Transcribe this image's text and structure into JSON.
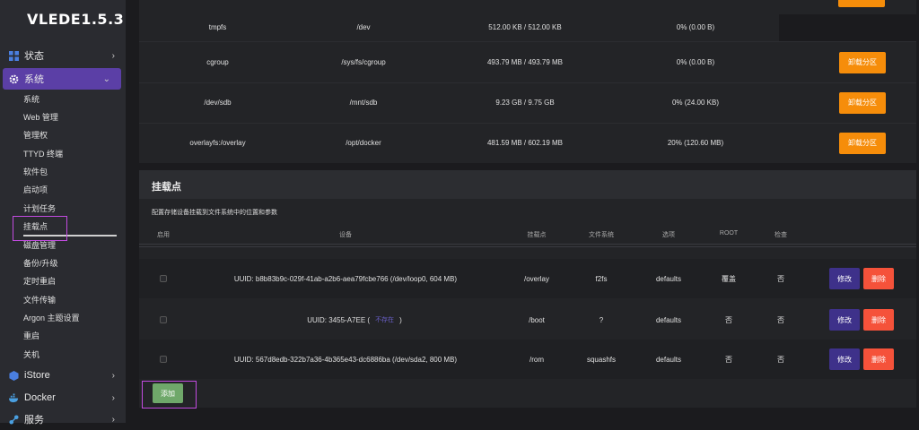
{
  "sidebar": {
    "logo": "VLEDE1.5.3",
    "top_items": [
      {
        "label": "状态",
        "icon": "grid-icon"
      },
      {
        "label": "系统",
        "icon": "gear-icon"
      },
      {
        "label": "iStore",
        "icon": "istore-icon"
      },
      {
        "label": "Docker",
        "icon": "docker-icon"
      },
      {
        "label": "服务",
        "icon": "services-icon"
      }
    ],
    "sub_items": [
      "系统",
      "Web 管理",
      "管理权",
      "TTYD 终端",
      "软件包",
      "启动项",
      "计划任务",
      "挂载点",
      "磁盘管理",
      "备份/升级",
      "定时重启",
      "文件传输",
      "Argon 主题设置",
      "重启",
      "关机"
    ]
  },
  "storage_rows": [
    {
      "fs": "tmpfs",
      "mount": "/dev",
      "size": "512.00 KB / 512.00 KB",
      "usage": "0% (0.00 B)",
      "action": ""
    },
    {
      "fs": "cgroup",
      "mount": "/sys/fs/cgroup",
      "size": "493.79 MB / 493.79 MB",
      "usage": "0% (0.00 B)",
      "action": "卸载分区"
    },
    {
      "fs": "/dev/sdb",
      "mount": "/mnt/sdb",
      "size": "9.23 GB / 9.75 GB",
      "usage": "0% (24.00 KB)",
      "action": "卸载分区"
    },
    {
      "fs": "overlayfs:/overlay",
      "mount": "/opt/docker",
      "size": "481.59 MB / 602.19 MB",
      "usage": "20% (120.60 MB)",
      "action": "卸载分区"
    }
  ],
  "mounts_panel": {
    "title": "挂载点",
    "description": "配置存储设备挂载到文件系统中的位置和参数",
    "headers": [
      "启用",
      "设备",
      "挂载点",
      "文件系统",
      "选项",
      "ROOT",
      "检查"
    ],
    "rows": [
      {
        "device": "UUID: b8b83b9c-029f-41ab-a2b6-aea79fcbe766 (/dev/loop0, 604 MB)",
        "mount": "/overlay",
        "fs": "f2fs",
        "options": "defaults",
        "root": "覆盖",
        "check": "否"
      },
      {
        "device_prefix": "UUID: 3455-A7EE (",
        "device_missing": "不存在",
        "device_suffix": ")",
        "mount": "/boot",
        "fs": "?",
        "options": "defaults",
        "root": "否",
        "check": "否"
      },
      {
        "device": "UUID: 567d8edb-322b7a36-4b365e43-dc6886ba (/dev/sda2, 800 MB)",
        "mount": "/rom",
        "fs": "squashfs",
        "options": "defaults",
        "root": "否",
        "check": "否"
      }
    ],
    "edit_label": "修改",
    "delete_label": "删除",
    "add_label": "添加"
  },
  "colors": {
    "accent": "#5b3fa6",
    "unmount": "#f68d0a",
    "edit": "#3e318a",
    "delete": "#f5523a",
    "add": "#6fa86a"
  }
}
